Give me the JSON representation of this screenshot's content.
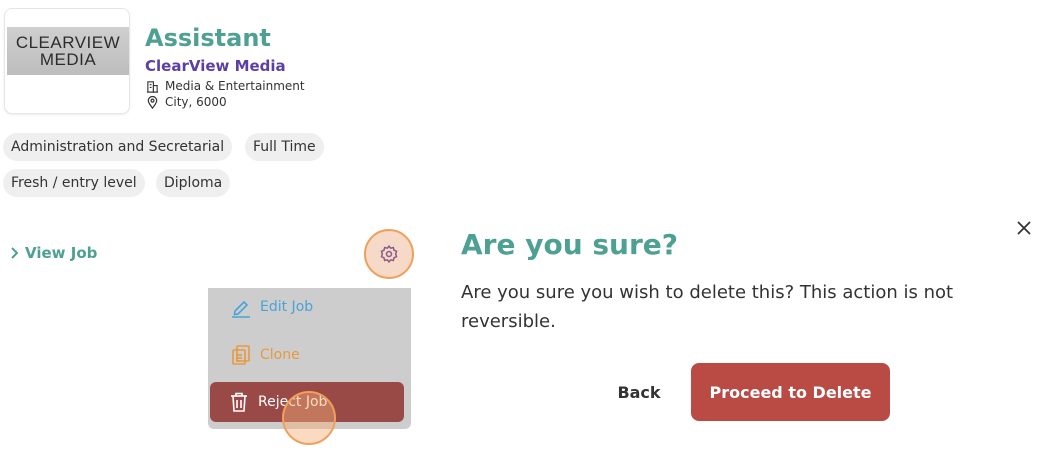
{
  "job": {
    "logo_line1": "CLEARVIEW",
    "logo_line2": "MEDIA",
    "title": "Assistant",
    "company": "ClearView Media",
    "industry": "Media & Entertainment",
    "location": "City, 6000",
    "tags": [
      "Administration and Secretarial",
      "Full Time",
      "Fresh / entry level",
      "Diploma"
    ],
    "view_job_label": "View Job"
  },
  "menu": {
    "items": [
      {
        "label": "Edit Job",
        "icon": "pencil-icon"
      },
      {
        "label": "Clone",
        "icon": "copy-icon"
      },
      {
        "label": "Reject Job",
        "icon": "trash-icon"
      }
    ]
  },
  "modal": {
    "title": "Are you sure?",
    "message": "Are you sure you wish to delete this? This action is not reversible.",
    "back_label": "Back",
    "proceed_label": "Proceed to Delete"
  },
  "colors": {
    "accent": "#4da092",
    "company": "#5a3fa7",
    "danger": "#b94a44",
    "highlight": "#f0a05a"
  }
}
